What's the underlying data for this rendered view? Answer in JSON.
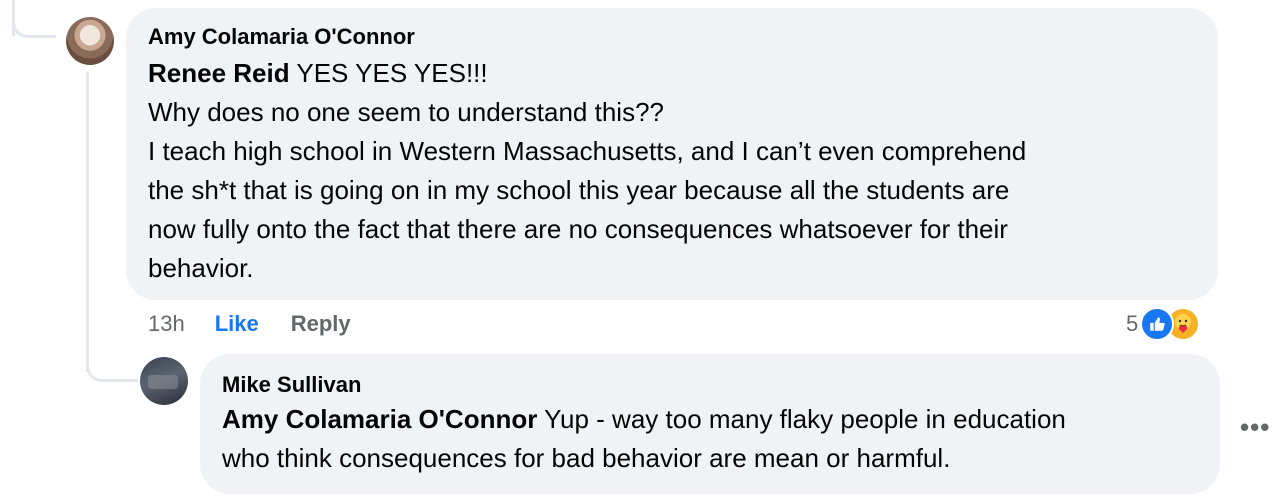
{
  "comment": {
    "author": "Amy Colamaria O'Connor",
    "mention": "Renee Reid",
    "lines": [
      " YES YES YES!!!",
      "Why does no one seem to understand this??",
      "I teach high school in Western Massachusetts, and I can’t even comprehend",
      "the sh*t that is going on in my school this year because all the students are",
      "now fully onto the fact that there are no consequences whatsoever for their",
      "behavior."
    ],
    "timestamp": "13h",
    "like_label": "Like",
    "reply_label": "Reply",
    "reaction_count": "5",
    "reactions": [
      "like-reaction-icon",
      "care-reaction-icon"
    ]
  },
  "reply": {
    "author": "Mike Sullivan",
    "mention": "Amy Colamaria O'Connor",
    "text_line1": " Yup - way too many flaky people in education",
    "text_line2": "who think consequences for bad behavior are mean or harmful."
  },
  "more_options": "•••",
  "colors": {
    "bubble": "#f0f2f5",
    "link_blue": "#1877f2",
    "secondary_text": "#65676b"
  }
}
